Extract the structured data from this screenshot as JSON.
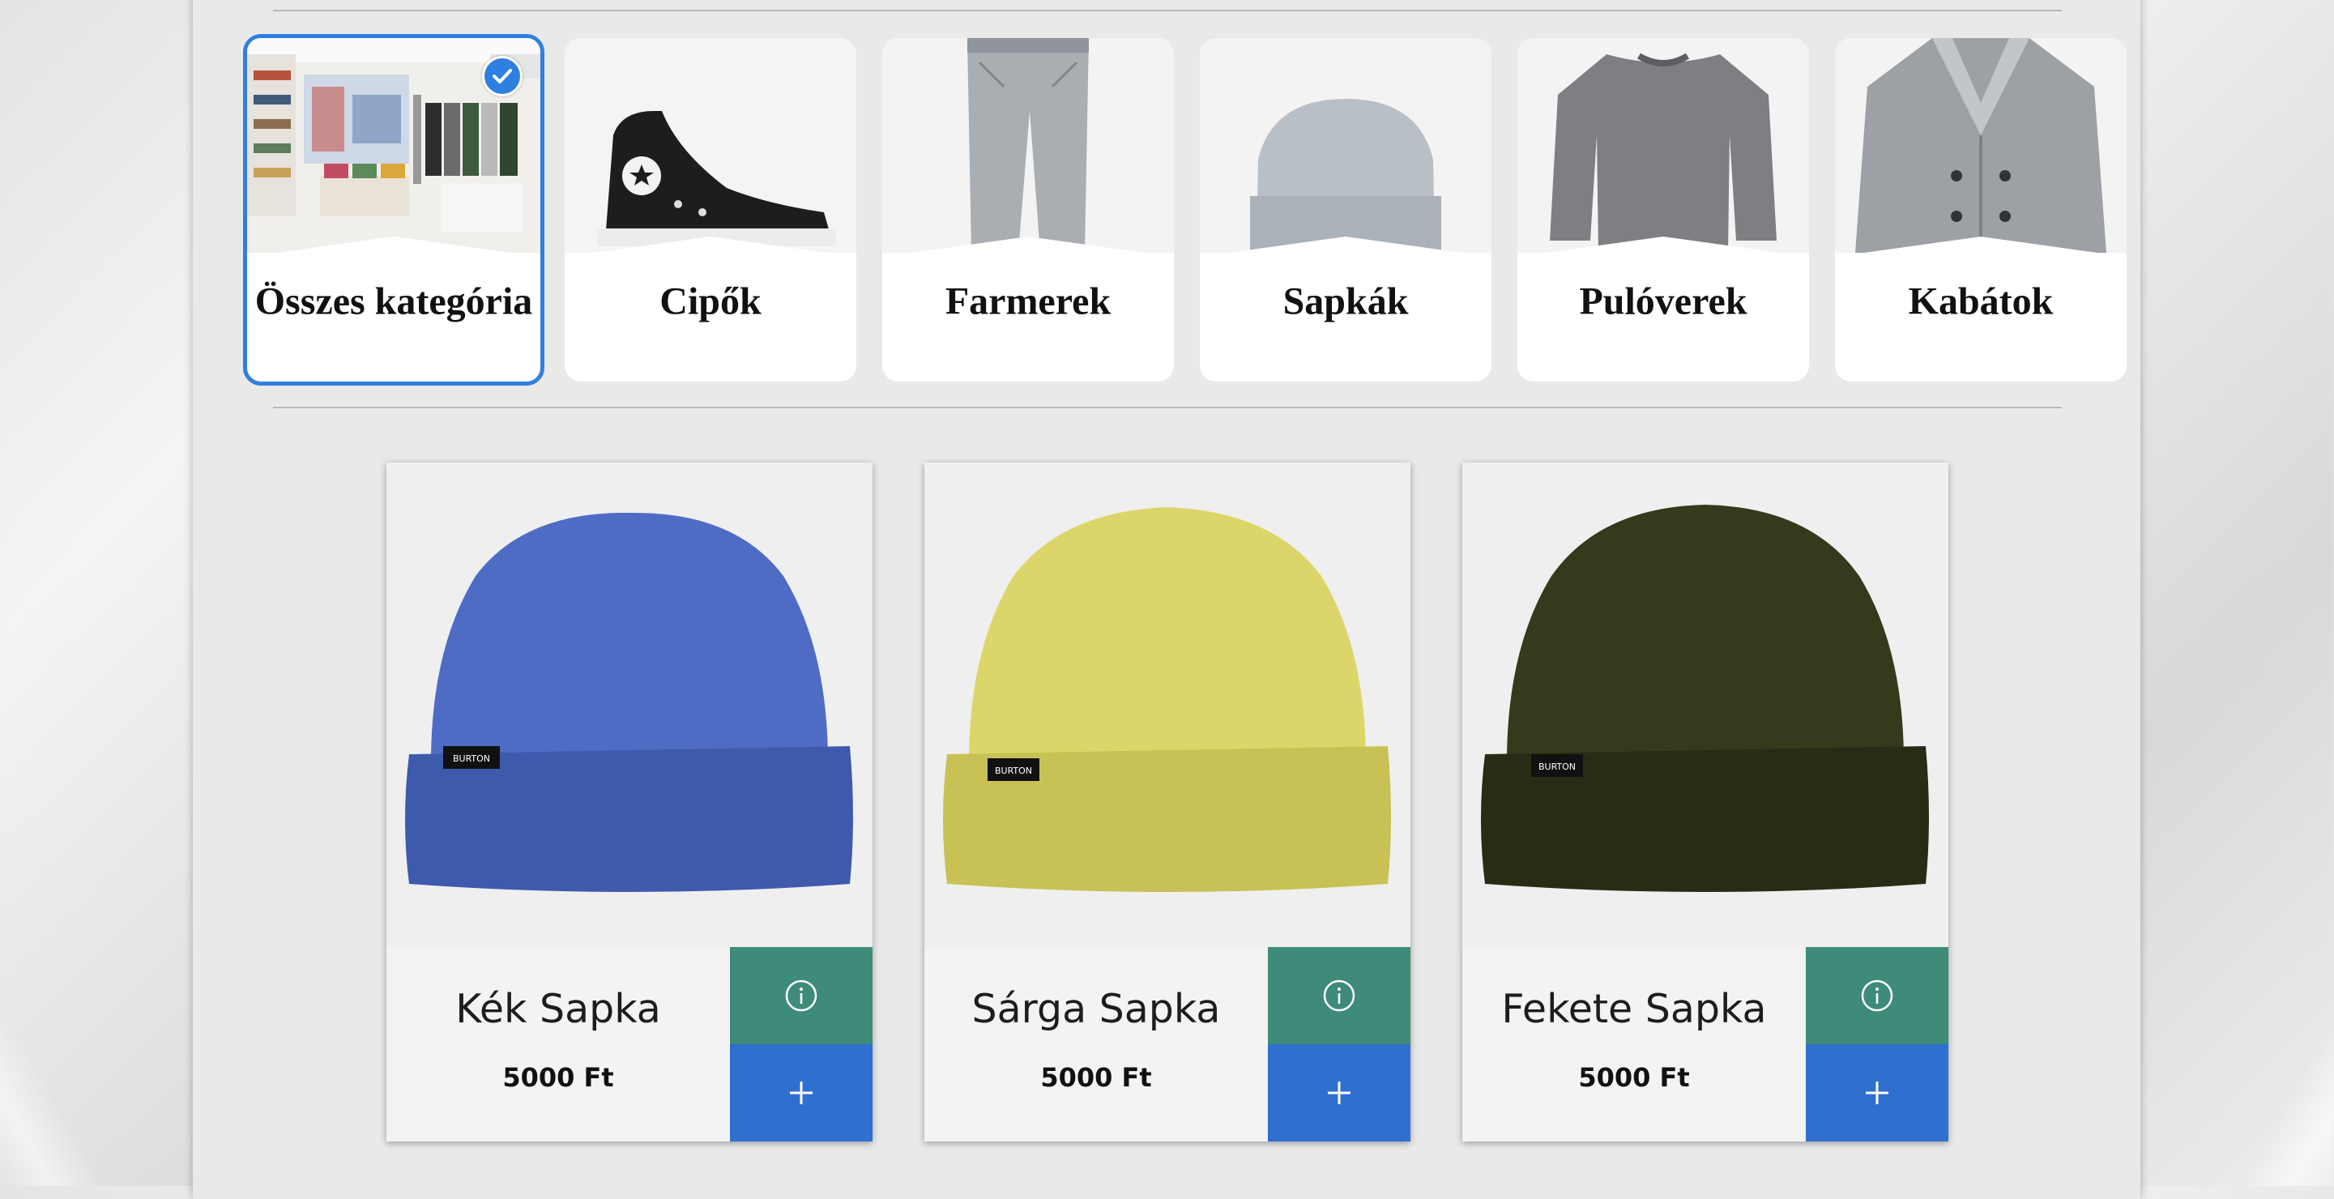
{
  "categories": [
    {
      "label": "Összes kategória",
      "selected": true,
      "icon": "store-interior"
    },
    {
      "label": "Cipők",
      "selected": false,
      "icon": "sneaker"
    },
    {
      "label": "Farmerek",
      "selected": false,
      "icon": "jeans"
    },
    {
      "label": "Sapkák",
      "selected": false,
      "icon": "beanie"
    },
    {
      "label": "Pulóverek",
      "selected": false,
      "icon": "sweater"
    },
    {
      "label": "Kabátok",
      "selected": false,
      "icon": "coat"
    }
  ],
  "products": [
    {
      "name": "Kék Sapka",
      "price": "5000 Ft",
      "color": "#4f6cc4",
      "shade": "#3f5aad",
      "tag": "BURTON"
    },
    {
      "name": "Sárga Sapka",
      "price": "5000 Ft",
      "color": "#dcd66a",
      "shade": "#c8c155",
      "tag": "BURTON"
    },
    {
      "name": "Fekete Sapka",
      "price": "5000 Ft",
      "color": "#343a1c",
      "shade": "#272c14",
      "tag": "BURTON"
    }
  ],
  "colors": {
    "selected_border": "#2f7fe0",
    "info_button": "#3e8b7a",
    "add_button": "#2f6fd0"
  }
}
